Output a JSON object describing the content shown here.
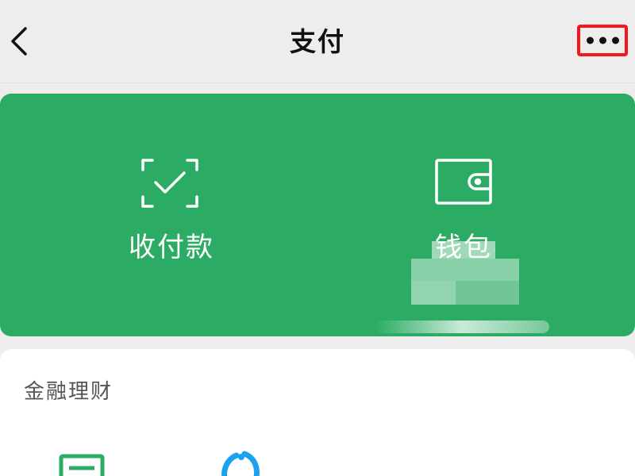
{
  "header": {
    "title": "支付",
    "back_icon": "chevron-left-icon",
    "more_icon": "more-dots-icon",
    "highlight_color": "#f5151b"
  },
  "card": {
    "background": "#2bab63",
    "items": [
      {
        "label": "收付款",
        "icon": "scan-check-icon"
      },
      {
        "label": "钱包",
        "icon": "wallet-icon"
      }
    ]
  },
  "finance": {
    "title": "金融理财",
    "items": [
      {
        "icon": "finance-card-icon"
      },
      {
        "icon": "finance-swirl-icon"
      }
    ]
  }
}
